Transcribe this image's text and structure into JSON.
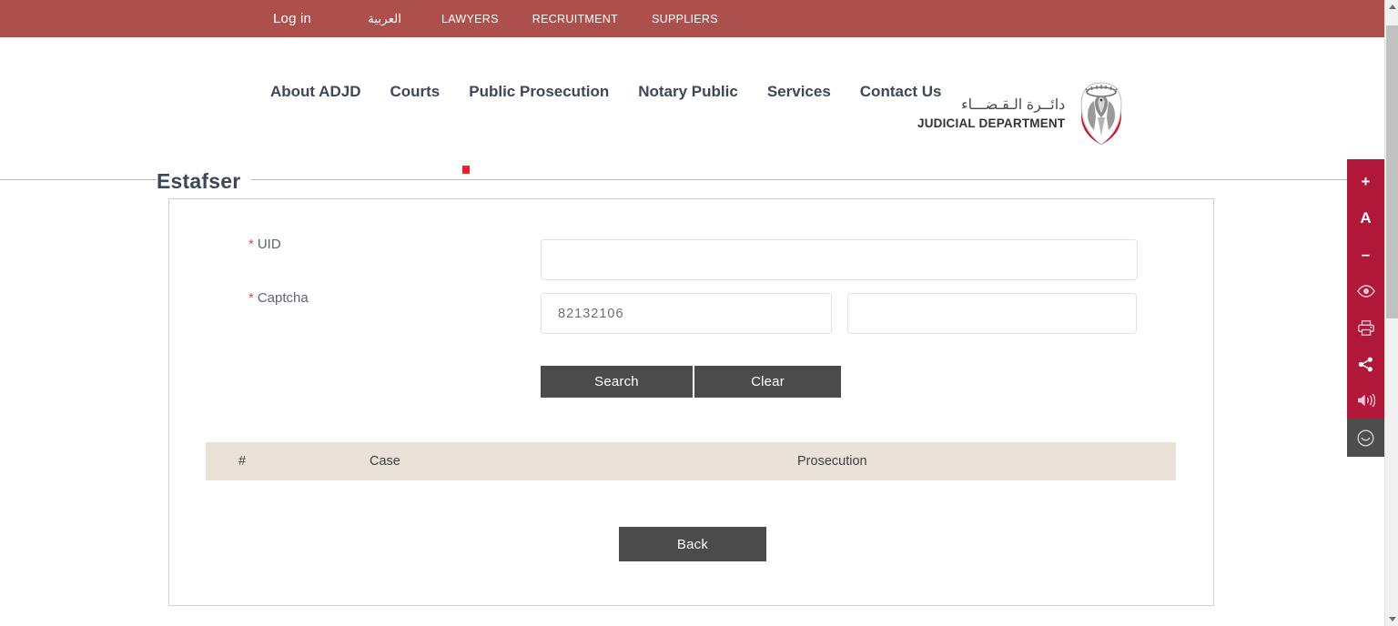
{
  "topbar": {
    "login_label": "Log in",
    "links": [
      {
        "label": "العربية",
        "name": "arabic"
      },
      {
        "label": "LAWYERS",
        "name": "lawyers"
      },
      {
        "label": "RECRUITMENT",
        "name": "recruitment"
      },
      {
        "label": "SUPPLIERS",
        "name": "suppliers"
      }
    ],
    "background_color": "#ad4f4d"
  },
  "nav": {
    "items": [
      {
        "label": "About ADJD"
      },
      {
        "label": "Courts"
      },
      {
        "label": "Public Prosecution"
      },
      {
        "label": "Notary Public"
      },
      {
        "label": "Services"
      },
      {
        "label": "Contact Us"
      }
    ]
  },
  "logo": {
    "arabic": "دائــرة الـقـضـــاء",
    "english": "JUDICIAL DEPARTMENT"
  },
  "page": {
    "title": "Estafser"
  },
  "form": {
    "uid": {
      "label": "UID",
      "required_mark": "*",
      "value": "",
      "placeholder": ""
    },
    "captcha": {
      "label": "Captcha",
      "required_mark": "*",
      "code": "82132106",
      "value": "",
      "placeholder": ""
    },
    "buttons": {
      "search": "Search",
      "clear": "Clear",
      "back": "Back"
    }
  },
  "results_table": {
    "headers": [
      "#",
      "Case",
      "Prosecution"
    ],
    "rows": []
  },
  "accessibility_rail": {
    "background_color": "#b01739",
    "items": [
      {
        "name": "increase-text-size",
        "glyph": "+"
      },
      {
        "name": "reset-text-size",
        "glyph": "A"
      },
      {
        "name": "decrease-text-size",
        "glyph": "–"
      },
      {
        "name": "contrast-eye-icon",
        "glyph": ""
      },
      {
        "name": "print-icon",
        "glyph": ""
      },
      {
        "name": "share-icon",
        "glyph": ""
      },
      {
        "name": "read-aloud-icon",
        "glyph": ""
      },
      {
        "name": "feedback-smiley-icon",
        "glyph": ""
      }
    ]
  }
}
